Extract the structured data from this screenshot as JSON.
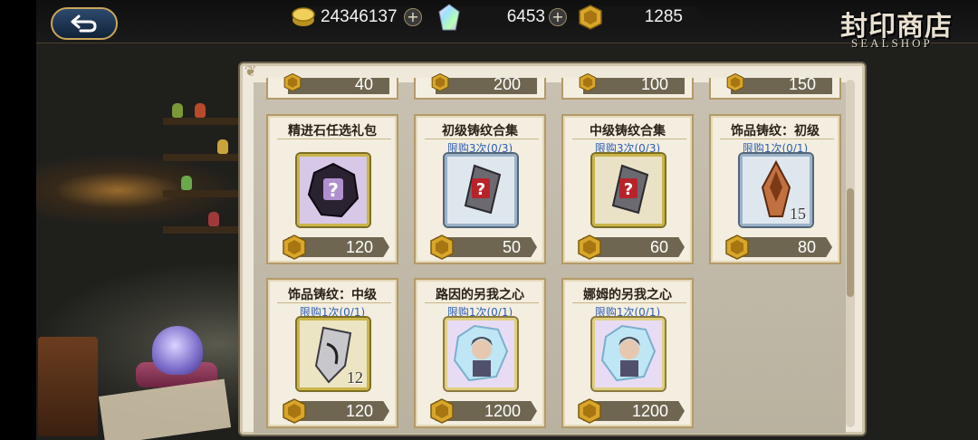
{
  "header": {
    "title_cn": "封印商店",
    "title_en": "SEALSHOP"
  },
  "resources": {
    "gold": "24346137",
    "crystal": "6453",
    "token": "1285"
  },
  "icons": {
    "back": "back-arrow-icon",
    "gold": "gold-coin-icon",
    "crystal": "rainbow-crystal-icon",
    "token": "seal-token-icon",
    "add": "plus-icon",
    "price": "seal-token-icon"
  },
  "top_row_prices": [
    "40",
    "200",
    "100",
    "150"
  ],
  "items": [
    {
      "name": "精进石任选礼包",
      "limit": "",
      "price": "120",
      "qty": "",
      "frame": "gold",
      "icon": "mystery-dark-stone-icon"
    },
    {
      "name": "初级铸纹合集",
      "limit": "限购3次(0/3)",
      "price": "50",
      "qty": "",
      "frame": "silver",
      "icon": "mystery-rune-red-icon"
    },
    {
      "name": "中级铸纹合集",
      "limit": "限购3次(0/3)",
      "price": "60",
      "qty": "",
      "frame": "gold",
      "icon": "mystery-rune-silver-icon"
    },
    {
      "name": "饰品铸纹：初级",
      "limit": "限购1次(0/1)",
      "price": "80",
      "qty": "15",
      "frame": "silver",
      "icon": "bronze-rune-shard-icon"
    },
    {
      "name": "饰品铸纹：中级",
      "limit": "限购1次(0/1)",
      "price": "120",
      "qty": "12",
      "frame": "gold",
      "icon": "silver-rune-shard-icon"
    },
    {
      "name": "路因的另我之心",
      "limit": "限购1次(0/1)",
      "price": "1200",
      "qty": "",
      "frame": "rainbow",
      "icon": "crystal-heart-portrait-icon"
    },
    {
      "name": "娜姆的另我之心",
      "limit": "限购1次(0/1)",
      "price": "1200",
      "qty": "",
      "frame": "rainbow",
      "icon": "crystal-heart-portrait-icon"
    }
  ],
  "colors": {
    "limit_text": "#2f5fb5",
    "panel_bg": "#efe9dc",
    "card_border": "#b39a68"
  }
}
